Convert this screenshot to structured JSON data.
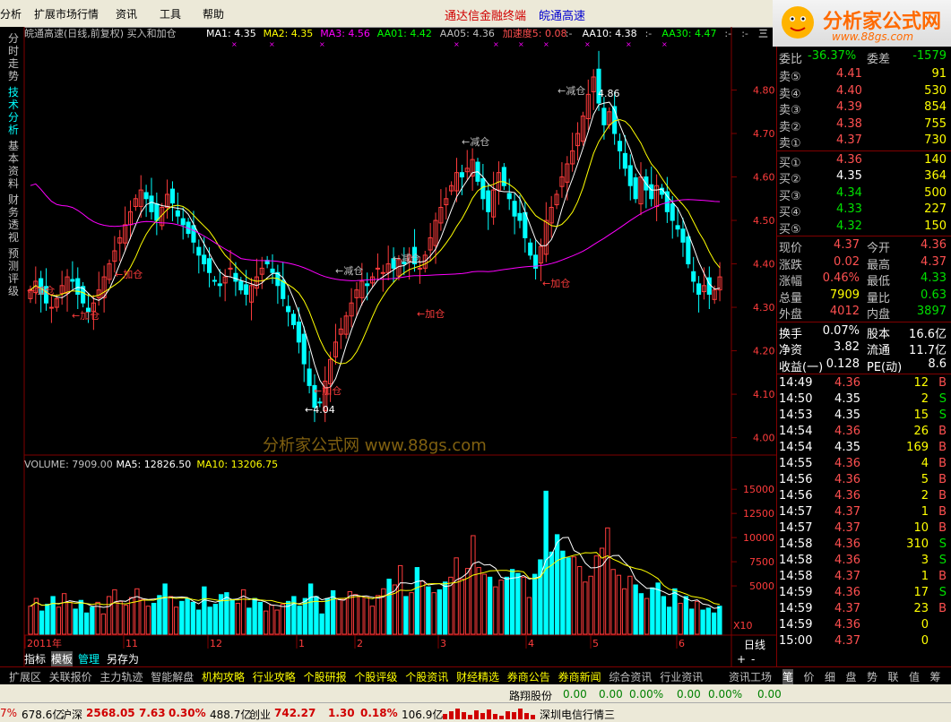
{
  "menu": {
    "items": [
      "分析",
      "扩展市场行情",
      "资讯",
      "工具",
      "帮助"
    ]
  },
  "app_title": "通达信金融终端",
  "app_subtitle": "皖通高速",
  "logo": {
    "brand": "分析家公式网",
    "url": "www.88gs.com"
  },
  "left_tabs": [
    "分时走势",
    "技术分析",
    "基本资料",
    "财务透视",
    "预测评级"
  ],
  "chart_header": {
    "name": "皖通高速(日线,前复权) 买入和加仓",
    "items": [
      {
        "label": "MA1: 4.35",
        "color": "#ffffff"
      },
      {
        "label": "MA2: 4.35",
        "color": "#ffff00"
      },
      {
        "label": "MA3: 4.56",
        "color": "#ff00ff"
      },
      {
        "label": "AA01: 4.42",
        "color": "#00ff00"
      },
      {
        "label": "AA05: 4.36",
        "color": "#c0c0c0"
      },
      {
        "label": "加速度5: 0.08",
        "color": "#ff5050"
      },
      {
        "label": ":-",
        "color": "#c0c0c0"
      },
      {
        "label": "AA10: 4.38",
        "color": "#ffffff"
      },
      {
        "label": ":-",
        "color": "#c0c0c0"
      },
      {
        "label": "AA30: 4.47",
        "color": "#00ff00"
      },
      {
        "label": ":-",
        "color": "#c0c0c0"
      },
      {
        "label": ":-",
        "color": "#c0c0c0"
      },
      {
        "label": "三",
        "color": "#ffffff"
      }
    ]
  },
  "watermark": "分析家公式网  www.88gs.com",
  "chart_data": [
    {
      "type": "candlestick",
      "title": "皖通高速(日线,前复权) 买入和加仓",
      "y_ticks": [
        4.8,
        4.7,
        4.6,
        4.5,
        4.4,
        4.3,
        4.2,
        4.1,
        4.0
      ],
      "ylim": [
        3.96,
        4.9
      ],
      "x_labels": [
        "2011年",
        "11",
        "12",
        "1",
        "2",
        "3",
        "4",
        "5",
        "6"
      ],
      "high_label": "4.86",
      "low_label": "4.04",
      "annotations": [
        "←加仓",
        "←加仓",
        "←加仓",
        "←减仓",
        "←减仓",
        "←加仓",
        "←加仓",
        "←减仓",
        "←减仓",
        "←加仓"
      ],
      "colors": {
        "up": "#ff3c3c",
        "down": "#00ffff",
        "ma1": "#ffffff",
        "ma2": "#ffff00",
        "ma3": "#ff00ff"
      },
      "series": [
        {
          "name": "MA1",
          "values_note": "white line"
        },
        {
          "name": "MA2",
          "values_note": "yellow line"
        },
        {
          "name": "MA3",
          "values_note": "magenta line"
        }
      ],
      "close": [
        4.34,
        4.36,
        4.33,
        4.31,
        4.3,
        4.32,
        4.35,
        4.37,
        4.36,
        4.33,
        4.31,
        4.29,
        4.31,
        4.34,
        4.37,
        4.4,
        4.43,
        4.46,
        4.49,
        4.52,
        4.55,
        4.57,
        4.55,
        4.52,
        4.5,
        4.53,
        4.56,
        4.54,
        4.51,
        4.49,
        4.47,
        4.45,
        4.42,
        4.4,
        4.38,
        4.36,
        4.35,
        4.37,
        4.39,
        4.36,
        4.34,
        4.33,
        4.35,
        4.37,
        4.39,
        4.4,
        4.38,
        4.35,
        4.32,
        4.29,
        4.26,
        4.22,
        4.17,
        4.12,
        4.07,
        4.08,
        4.13,
        4.18,
        4.22,
        4.25,
        4.28,
        4.31,
        4.34,
        4.36,
        4.35,
        4.37,
        4.39,
        4.38,
        4.4,
        4.39,
        4.41,
        4.4,
        4.42,
        4.4,
        4.39,
        4.42,
        4.46,
        4.5,
        4.53,
        4.55,
        4.58,
        4.61,
        4.6,
        4.62,
        4.64,
        4.59,
        4.55,
        4.52,
        4.57,
        4.61,
        4.58,
        4.55,
        4.51,
        4.5,
        4.46,
        4.42,
        4.39,
        4.44,
        4.5,
        4.53,
        4.56,
        4.6,
        4.63,
        4.66,
        4.7,
        4.74,
        4.79,
        4.83,
        4.77,
        4.72,
        4.75,
        4.7,
        4.66,
        4.62,
        4.58,
        4.55,
        4.6,
        4.57,
        4.55,
        4.58,
        4.56,
        4.52,
        4.5,
        4.48,
        4.45,
        4.4,
        4.36,
        4.33,
        4.35,
        4.33,
        4.34,
        4.37
      ]
    },
    {
      "type": "bar",
      "title": "VOLUME: 7909.00",
      "series_labels": [
        {
          "label": "VOLUME: 7909.00",
          "color": "#c0c0c0"
        },
        {
          "label": "MA5: 12826.50",
          "color": "#ffffff"
        },
        {
          "label": "MA10: 13206.75",
          "color": "#ffff00"
        }
      ],
      "y_ticks": [
        15000,
        12500,
        10000,
        7500,
        5000
      ],
      "ylim": [
        0,
        16500
      ],
      "unit_label": "X10",
      "values": [
        2900,
        3700,
        2400,
        3100,
        3900,
        2800,
        4200,
        3300,
        2600,
        3500,
        2200,
        2800,
        3300,
        2100,
        3900,
        4600,
        3400,
        3000,
        3800,
        4700,
        3600,
        2900,
        3200,
        4000,
        5200,
        3900,
        2800,
        3400,
        3700,
        3300,
        2500,
        4900,
        2800,
        3100,
        4100,
        4300,
        3600,
        3200,
        4600,
        2700,
        3700,
        3300,
        2400,
        3000,
        2500,
        3100,
        3400,
        3900,
        2900,
        3700,
        5200,
        3900,
        2100,
        3700,
        4500,
        3700,
        3600,
        4400,
        4100,
        3900,
        3800,
        2900,
        4000,
        4700,
        5700,
        5100,
        7100,
        3900,
        4300,
        6900,
        5500,
        4900,
        4300,
        4600,
        5400,
        5900,
        7900,
        5700,
        6800,
        10200,
        6900,
        6200,
        5900,
        4900,
        5600,
        5900,
        6700,
        6300,
        5900,
        3800,
        6200,
        7700,
        14800,
        8500,
        10300,
        8600,
        7900,
        8000,
        7000,
        5400,
        6000,
        8100,
        8900,
        11000,
        6700,
        6100,
        4700,
        6000,
        5100,
        4200,
        3700,
        4800,
        5300,
        3900,
        2800,
        4700,
        3200,
        3900,
        2600,
        3400,
        2500,
        2700,
        2200,
        2900
      ]
    }
  ],
  "quote_panel": {
    "weibi": {
      "label": "委比",
      "value": "-36.37%",
      "label2": "委差",
      "value2": "-1579"
    },
    "sell": [
      {
        "label": "卖⑤",
        "price": "4.41",
        "vol": "91"
      },
      {
        "label": "卖④",
        "price": "4.40",
        "vol": "530"
      },
      {
        "label": "卖③",
        "price": "4.39",
        "vol": "854"
      },
      {
        "label": "卖②",
        "price": "4.38",
        "vol": "755"
      },
      {
        "label": "卖①",
        "price": "4.37",
        "vol": "730"
      }
    ],
    "buy": [
      {
        "label": "买①",
        "price": "4.36",
        "vol": "140"
      },
      {
        "label": "买②",
        "price": "4.35",
        "vol": "364"
      },
      {
        "label": "买③",
        "price": "4.34",
        "vol": "500"
      },
      {
        "label": "买④",
        "price": "4.33",
        "vol": "227"
      },
      {
        "label": "买⑤",
        "price": "4.32",
        "vol": "150"
      }
    ],
    "stats": [
      {
        "l1": "现价",
        "v1": "4.37",
        "l2": "今开",
        "v2": "4.36",
        "c1": "red",
        "c2": "red"
      },
      {
        "l1": "涨跌",
        "v1": "0.02",
        "l2": "最高",
        "v2": "4.37",
        "c1": "red",
        "c2": "red"
      },
      {
        "l1": "涨幅",
        "v1": "0.46%",
        "l2": "最低",
        "v2": "4.33",
        "c1": "red",
        "c2": "green"
      },
      {
        "l1": "总量",
        "v1": "7909",
        "l2": "量比",
        "v2": "0.63",
        "c1": "yellow",
        "c2": "green"
      },
      {
        "l1": "外盘",
        "v1": "4012",
        "l2": "内盘",
        "v2": "3897",
        "c1": "red",
        "c2": "green"
      }
    ],
    "stats2": [
      {
        "l1": "换手",
        "v1": "0.07%",
        "l2": "股本",
        "v2": "16.6亿"
      },
      {
        "l1": "净资",
        "v1": "3.82",
        "l2": "流通",
        "v2": "11.7亿"
      },
      {
        "l1": "收益(一)",
        "v1": "0.128",
        "l2": "PE(动)",
        "v2": "8.6"
      }
    ],
    "ticks": [
      {
        "time": "14:49",
        "price": "4.36",
        "vol": "12",
        "bs": "B"
      },
      {
        "time": "14:50",
        "price": "4.35",
        "vol": "2",
        "bs": "S"
      },
      {
        "time": "14:53",
        "price": "4.35",
        "vol": "15",
        "bs": "S"
      },
      {
        "time": "14:54",
        "price": "4.36",
        "vol": "26",
        "bs": "B"
      },
      {
        "time": "14:54",
        "price": "4.35",
        "vol": "169",
        "bs": "B"
      },
      {
        "time": "14:55",
        "price": "4.36",
        "vol": "4",
        "bs": "B"
      },
      {
        "time": "14:56",
        "price": "4.36",
        "vol": "5",
        "bs": "B"
      },
      {
        "time": "14:56",
        "price": "4.36",
        "vol": "2",
        "bs": "B"
      },
      {
        "time": "14:57",
        "price": "4.37",
        "vol": "1",
        "bs": "B"
      },
      {
        "time": "14:57",
        "price": "4.37",
        "vol": "10",
        "bs": "B"
      },
      {
        "time": "14:58",
        "price": "4.36",
        "vol": "310",
        "bs": "S"
      },
      {
        "time": "14:58",
        "price": "4.36",
        "vol": "3",
        "bs": "S"
      },
      {
        "time": "14:58",
        "price": "4.37",
        "vol": "1",
        "bs": "B"
      },
      {
        "time": "14:59",
        "price": "4.36",
        "vol": "17",
        "bs": "S"
      },
      {
        "time": "14:59",
        "price": "4.37",
        "vol": "23",
        "bs": "B"
      },
      {
        "time": "14:59",
        "price": "4.36",
        "vol": "0",
        "bs": ""
      },
      {
        "time": "15:00",
        "price": "4.37",
        "vol": "0",
        "bs": ""
      }
    ]
  },
  "sub_tabs": [
    "指标",
    "模板",
    "管理",
    "另存为"
  ],
  "period": "日线",
  "zoom_controls": [
    "+",
    "-"
  ],
  "bottom_tabs": [
    "扩展区",
    "关联报价",
    "主力轨迹",
    "智能解盘",
    "机构攻略",
    "行业攻略",
    "个股研报",
    "个股评级",
    "个股资讯",
    "财经精选",
    "券商公告",
    "券商新闻",
    "综合资讯",
    "行业资讯",
    "资讯工场"
  ],
  "right_tabs": [
    "笔",
    "价",
    "细",
    "盘",
    "势",
    "联",
    "值",
    "筹"
  ],
  "scroll_row": {
    "name": "路翔股份",
    "v1": "0.00",
    "v2": "0.00",
    "v3": "0.00%",
    "v4": "0.00",
    "v5": "0.00%",
    "v6": "0.00"
  },
  "status": {
    "sh_pct": "7%",
    "sh_amt": "678.6亿",
    "sz_label": "沪深",
    "sz_val": "2568.05",
    "sz_chg": "7.63",
    "sz_pct": "0.30%",
    "sz_amt": "488.7亿",
    "cy_label": "创业",
    "cy_val": "742.27",
    "cy_chg": "1.30",
    "cy_pct": "0.18%",
    "cy_amt": "106.9亿",
    "server": "深圳电信行情三"
  }
}
